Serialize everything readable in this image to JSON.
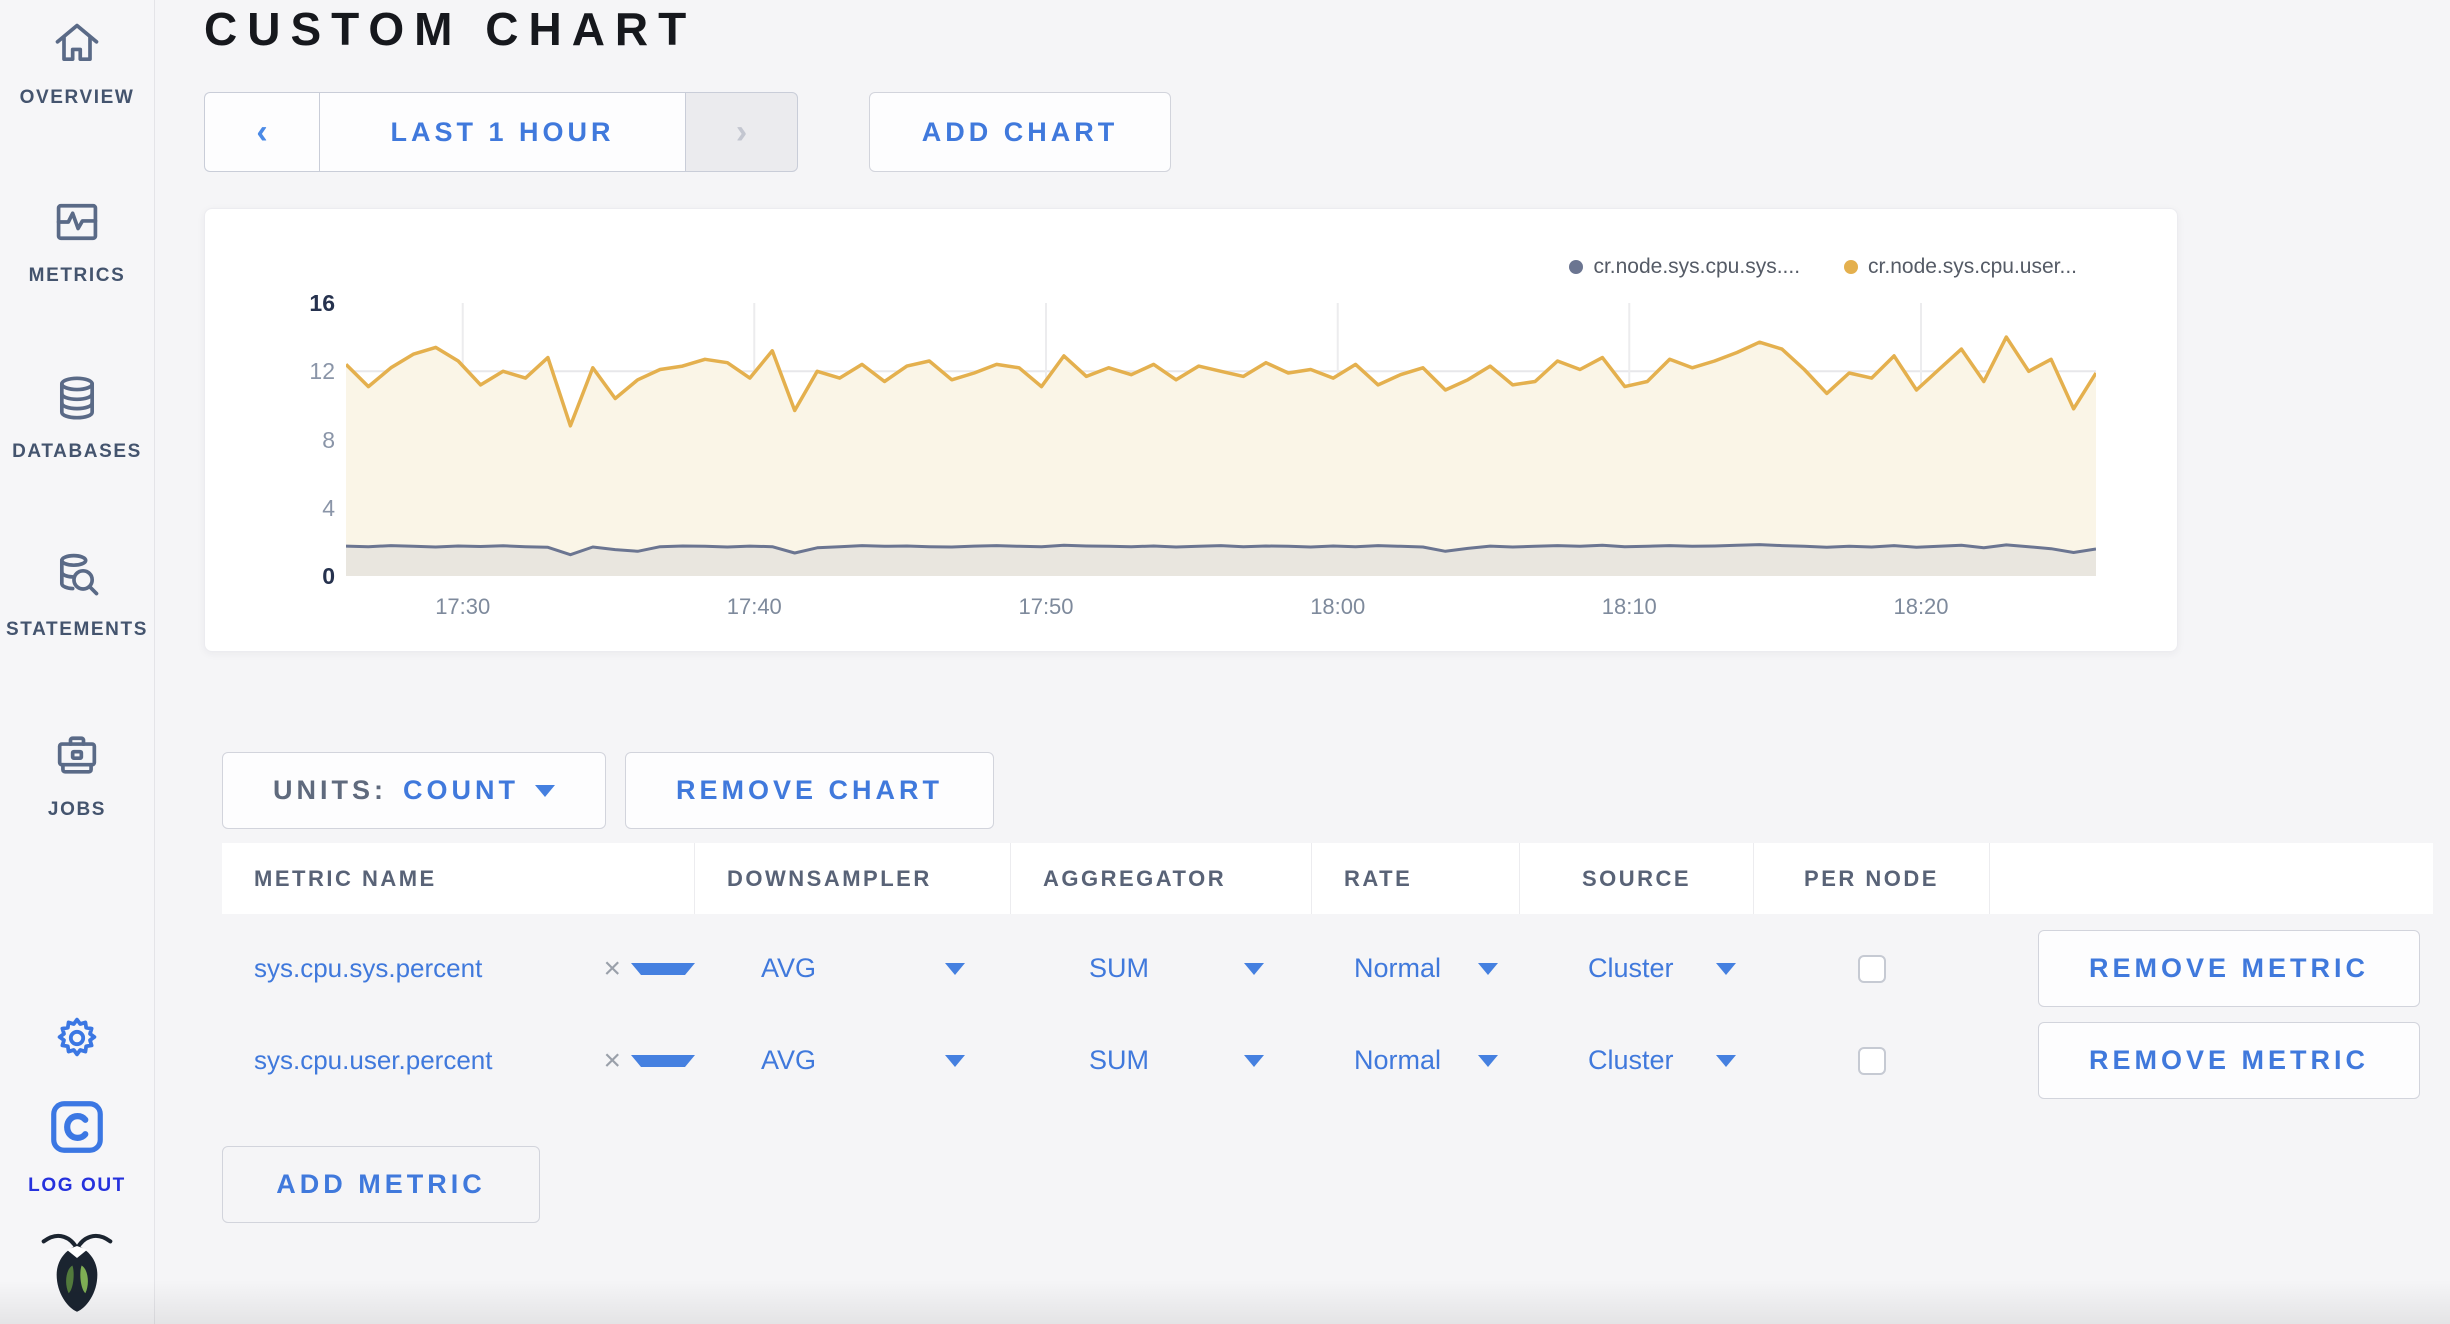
{
  "header": {
    "title": "CUSTOM CHART"
  },
  "sidebar": {
    "items": [
      {
        "label": "OVERVIEW",
        "icon": "home-icon"
      },
      {
        "label": "METRICS",
        "icon": "metrics-icon"
      },
      {
        "label": "DATABASES",
        "icon": "database-icon"
      },
      {
        "label": "STATEMENTS",
        "icon": "statements-icon"
      },
      {
        "label": "JOBS",
        "icon": "jobs-icon"
      }
    ],
    "settings_icon": "gear-icon",
    "logout": {
      "label": "LOG OUT",
      "icon": "cockroach-c-icon"
    },
    "logo_icon": "cockroach-bug-icon"
  },
  "toolbar": {
    "time_range": "LAST 1 HOUR",
    "prev_icon": "‹",
    "next_icon": "›",
    "add_chart": "ADD CHART"
  },
  "chart_data": {
    "type": "line",
    "title": "",
    "xlabel": "",
    "ylabel": "",
    "ylim": [
      0,
      16
    ],
    "yticks": [
      0,
      4,
      8,
      12,
      16
    ],
    "grid": true,
    "legend_position": "top-right",
    "x_ticks": [
      "17:30",
      "17:40",
      "17:50",
      "18:00",
      "18:10",
      "18:20"
    ],
    "x_tick_fractions": [
      0.0667,
      0.2333,
      0.4,
      0.5667,
      0.7333,
      0.9
    ],
    "series": [
      {
        "name": "cr.node.sys.cpu.sys....",
        "color": "#6b7591",
        "fill": "#e9e6df",
        "values": [
          1.75,
          1.72,
          1.78,
          1.74,
          1.7,
          1.76,
          1.73,
          1.77,
          1.72,
          1.68,
          1.25,
          1.7,
          1.55,
          1.45,
          1.72,
          1.76,
          1.74,
          1.7,
          1.75,
          1.72,
          1.35,
          1.65,
          1.72,
          1.78,
          1.74,
          1.76,
          1.72,
          1.7,
          1.75,
          1.78,
          1.74,
          1.72,
          1.8,
          1.76,
          1.74,
          1.72,
          1.76,
          1.7,
          1.74,
          1.78,
          1.72,
          1.76,
          1.74,
          1.7,
          1.76,
          1.72,
          1.78,
          1.74,
          1.7,
          1.45,
          1.62,
          1.75,
          1.7,
          1.74,
          1.78,
          1.74,
          1.8,
          1.72,
          1.74,
          1.78,
          1.74,
          1.76,
          1.8,
          1.84,
          1.78,
          1.74,
          1.68,
          1.74,
          1.7,
          1.78,
          1.68,
          1.74,
          1.8,
          1.66,
          1.82,
          1.72,
          1.6,
          1.38,
          1.58
        ]
      },
      {
        "name": "cr.node.sys.cpu.user...",
        "color": "#e4b04e",
        "fill": "#faf5e7",
        "values": [
          12.4,
          11.1,
          12.2,
          13.0,
          13.4,
          12.6,
          11.2,
          12.0,
          11.6,
          12.8,
          8.8,
          12.2,
          10.4,
          11.5,
          12.1,
          12.3,
          12.7,
          12.5,
          11.6,
          13.2,
          9.7,
          12.0,
          11.6,
          12.4,
          11.4,
          12.3,
          12.6,
          11.5,
          11.9,
          12.4,
          12.2,
          11.1,
          12.9,
          11.7,
          12.2,
          11.8,
          12.4,
          11.5,
          12.3,
          12.0,
          11.7,
          12.5,
          11.9,
          12.1,
          11.6,
          12.4,
          11.2,
          11.8,
          12.2,
          10.9,
          11.5,
          12.3,
          11.2,
          11.4,
          12.6,
          12.1,
          12.8,
          11.1,
          11.4,
          12.7,
          12.2,
          12.6,
          13.1,
          13.7,
          13.3,
          12.1,
          10.7,
          11.9,
          11.6,
          12.9,
          10.9,
          12.1,
          13.3,
          11.4,
          14.0,
          12.0,
          12.7,
          9.8,
          11.9
        ]
      }
    ]
  },
  "units": {
    "label": "UNITS:",
    "value": "COUNT"
  },
  "remove_chart_label": "REMOVE CHART",
  "table": {
    "headers": [
      "METRIC NAME",
      "DOWNSAMPLER",
      "AGGREGATOR",
      "RATE",
      "SOURCE",
      "PER NODE",
      ""
    ],
    "clear_icon": "×",
    "rows": [
      {
        "metric": "sys.cpu.sys.percent",
        "downsampler": "AVG",
        "aggregator": "SUM",
        "rate": "Normal",
        "source": "Cluster",
        "per_node": false,
        "action": "REMOVE METRIC"
      },
      {
        "metric": "sys.cpu.user.percent",
        "downsampler": "AVG",
        "aggregator": "SUM",
        "rate": "Normal",
        "source": "Cluster",
        "per_node": false,
        "action": "REMOVE METRIC"
      }
    ]
  },
  "add_metric_label": "ADD METRIC",
  "colors": {
    "accent_blue": "#4079dc",
    "logout_blue": "#2531dd",
    "nav_slate": "#5a6a87",
    "page_bg": "#f5f5f7",
    "user_series": "#e4b04e",
    "sys_series": "#6b7591"
  }
}
